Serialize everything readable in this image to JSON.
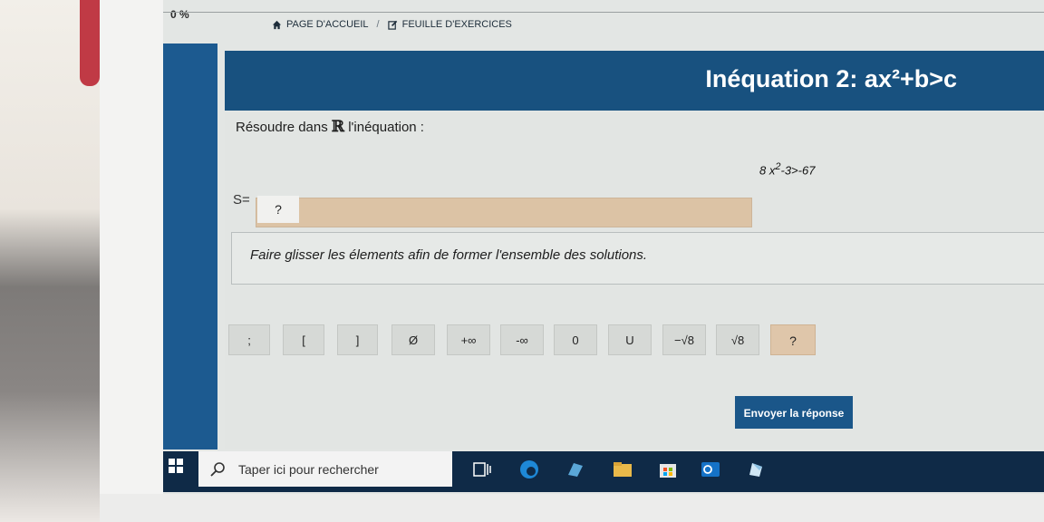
{
  "progress": "0 %",
  "breadcrumb": {
    "home": "PAGE D'ACCUEIL",
    "separator": "/",
    "exercises": "FEUILLE D'EXERCICES"
  },
  "title": "Inéquation 2: ax²+b>c",
  "prompt": {
    "before": "Résoudre dans",
    "set_symbol": "ℝ",
    "after": "l'inéquation :"
  },
  "equation": {
    "coef": "8",
    "var": "x",
    "exponent": "2",
    "rest": "-3>-67"
  },
  "solution_label": "S=",
  "solution_placeholder": "?",
  "instruction": "Faire glisser les élements afin de former l'ensemble des solutions.",
  "tiles": [
    ";",
    "[",
    "]",
    "Ø",
    "+∞",
    "-∞",
    "0",
    "U",
    "−√8",
    "√8",
    "?"
  ],
  "submit_label": "Envoyer la réponse",
  "taskbar": {
    "search_placeholder": "Taper ici pour rechercher"
  },
  "colors": {
    "header_blue": "#18517f",
    "answer_box": "#dcc3a5",
    "taskbar": "#0f2a47"
  }
}
